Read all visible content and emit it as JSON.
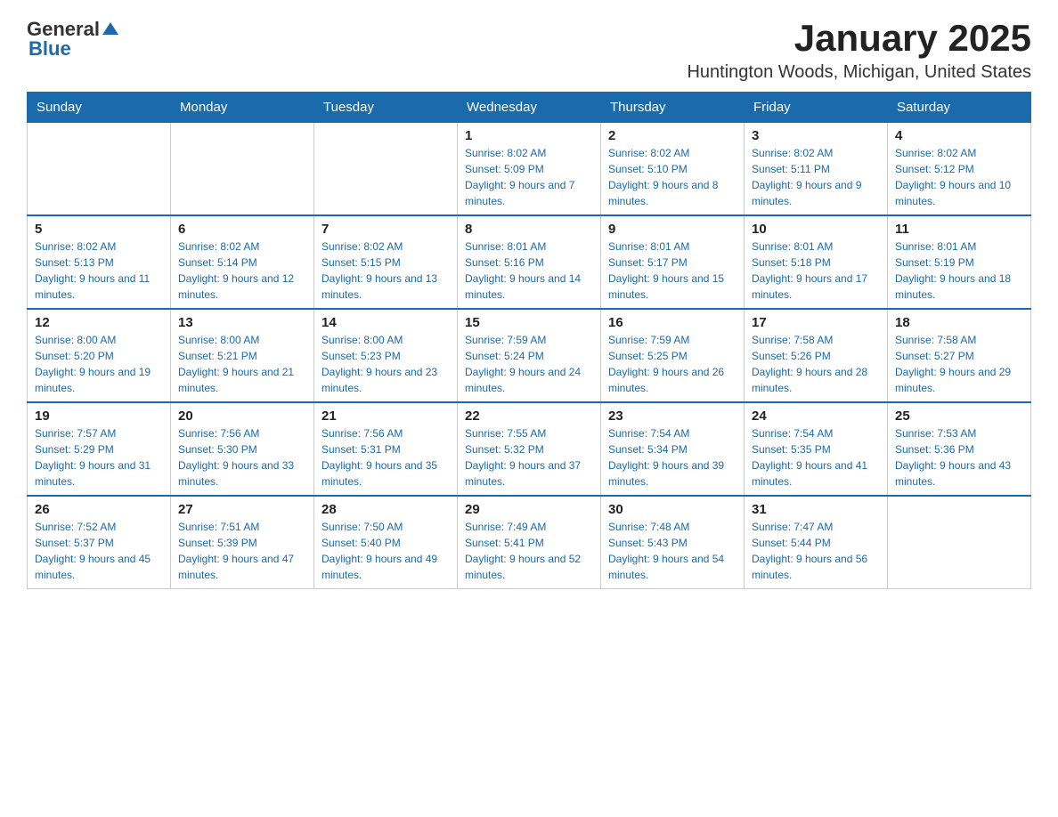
{
  "header": {
    "logo_general": "General",
    "logo_blue": "Blue",
    "title": "January 2025",
    "subtitle": "Huntington Woods, Michigan, United States"
  },
  "calendar": {
    "days_of_week": [
      "Sunday",
      "Monday",
      "Tuesday",
      "Wednesday",
      "Thursday",
      "Friday",
      "Saturday"
    ],
    "weeks": [
      [
        {
          "day": "",
          "info": ""
        },
        {
          "day": "",
          "info": ""
        },
        {
          "day": "",
          "info": ""
        },
        {
          "day": "1",
          "info": "Sunrise: 8:02 AM\nSunset: 5:09 PM\nDaylight: 9 hours and 7 minutes."
        },
        {
          "day": "2",
          "info": "Sunrise: 8:02 AM\nSunset: 5:10 PM\nDaylight: 9 hours and 8 minutes."
        },
        {
          "day": "3",
          "info": "Sunrise: 8:02 AM\nSunset: 5:11 PM\nDaylight: 9 hours and 9 minutes."
        },
        {
          "day": "4",
          "info": "Sunrise: 8:02 AM\nSunset: 5:12 PM\nDaylight: 9 hours and 10 minutes."
        }
      ],
      [
        {
          "day": "5",
          "info": "Sunrise: 8:02 AM\nSunset: 5:13 PM\nDaylight: 9 hours and 11 minutes."
        },
        {
          "day": "6",
          "info": "Sunrise: 8:02 AM\nSunset: 5:14 PM\nDaylight: 9 hours and 12 minutes."
        },
        {
          "day": "7",
          "info": "Sunrise: 8:02 AM\nSunset: 5:15 PM\nDaylight: 9 hours and 13 minutes."
        },
        {
          "day": "8",
          "info": "Sunrise: 8:01 AM\nSunset: 5:16 PM\nDaylight: 9 hours and 14 minutes."
        },
        {
          "day": "9",
          "info": "Sunrise: 8:01 AM\nSunset: 5:17 PM\nDaylight: 9 hours and 15 minutes."
        },
        {
          "day": "10",
          "info": "Sunrise: 8:01 AM\nSunset: 5:18 PM\nDaylight: 9 hours and 17 minutes."
        },
        {
          "day": "11",
          "info": "Sunrise: 8:01 AM\nSunset: 5:19 PM\nDaylight: 9 hours and 18 minutes."
        }
      ],
      [
        {
          "day": "12",
          "info": "Sunrise: 8:00 AM\nSunset: 5:20 PM\nDaylight: 9 hours and 19 minutes."
        },
        {
          "day": "13",
          "info": "Sunrise: 8:00 AM\nSunset: 5:21 PM\nDaylight: 9 hours and 21 minutes."
        },
        {
          "day": "14",
          "info": "Sunrise: 8:00 AM\nSunset: 5:23 PM\nDaylight: 9 hours and 23 minutes."
        },
        {
          "day": "15",
          "info": "Sunrise: 7:59 AM\nSunset: 5:24 PM\nDaylight: 9 hours and 24 minutes."
        },
        {
          "day": "16",
          "info": "Sunrise: 7:59 AM\nSunset: 5:25 PM\nDaylight: 9 hours and 26 minutes."
        },
        {
          "day": "17",
          "info": "Sunrise: 7:58 AM\nSunset: 5:26 PM\nDaylight: 9 hours and 28 minutes."
        },
        {
          "day": "18",
          "info": "Sunrise: 7:58 AM\nSunset: 5:27 PM\nDaylight: 9 hours and 29 minutes."
        }
      ],
      [
        {
          "day": "19",
          "info": "Sunrise: 7:57 AM\nSunset: 5:29 PM\nDaylight: 9 hours and 31 minutes."
        },
        {
          "day": "20",
          "info": "Sunrise: 7:56 AM\nSunset: 5:30 PM\nDaylight: 9 hours and 33 minutes."
        },
        {
          "day": "21",
          "info": "Sunrise: 7:56 AM\nSunset: 5:31 PM\nDaylight: 9 hours and 35 minutes."
        },
        {
          "day": "22",
          "info": "Sunrise: 7:55 AM\nSunset: 5:32 PM\nDaylight: 9 hours and 37 minutes."
        },
        {
          "day": "23",
          "info": "Sunrise: 7:54 AM\nSunset: 5:34 PM\nDaylight: 9 hours and 39 minutes."
        },
        {
          "day": "24",
          "info": "Sunrise: 7:54 AM\nSunset: 5:35 PM\nDaylight: 9 hours and 41 minutes."
        },
        {
          "day": "25",
          "info": "Sunrise: 7:53 AM\nSunset: 5:36 PM\nDaylight: 9 hours and 43 minutes."
        }
      ],
      [
        {
          "day": "26",
          "info": "Sunrise: 7:52 AM\nSunset: 5:37 PM\nDaylight: 9 hours and 45 minutes."
        },
        {
          "day": "27",
          "info": "Sunrise: 7:51 AM\nSunset: 5:39 PM\nDaylight: 9 hours and 47 minutes."
        },
        {
          "day": "28",
          "info": "Sunrise: 7:50 AM\nSunset: 5:40 PM\nDaylight: 9 hours and 49 minutes."
        },
        {
          "day": "29",
          "info": "Sunrise: 7:49 AM\nSunset: 5:41 PM\nDaylight: 9 hours and 52 minutes."
        },
        {
          "day": "30",
          "info": "Sunrise: 7:48 AM\nSunset: 5:43 PM\nDaylight: 9 hours and 54 minutes."
        },
        {
          "day": "31",
          "info": "Sunrise: 7:47 AM\nSunset: 5:44 PM\nDaylight: 9 hours and 56 minutes."
        },
        {
          "day": "",
          "info": ""
        }
      ]
    ]
  }
}
